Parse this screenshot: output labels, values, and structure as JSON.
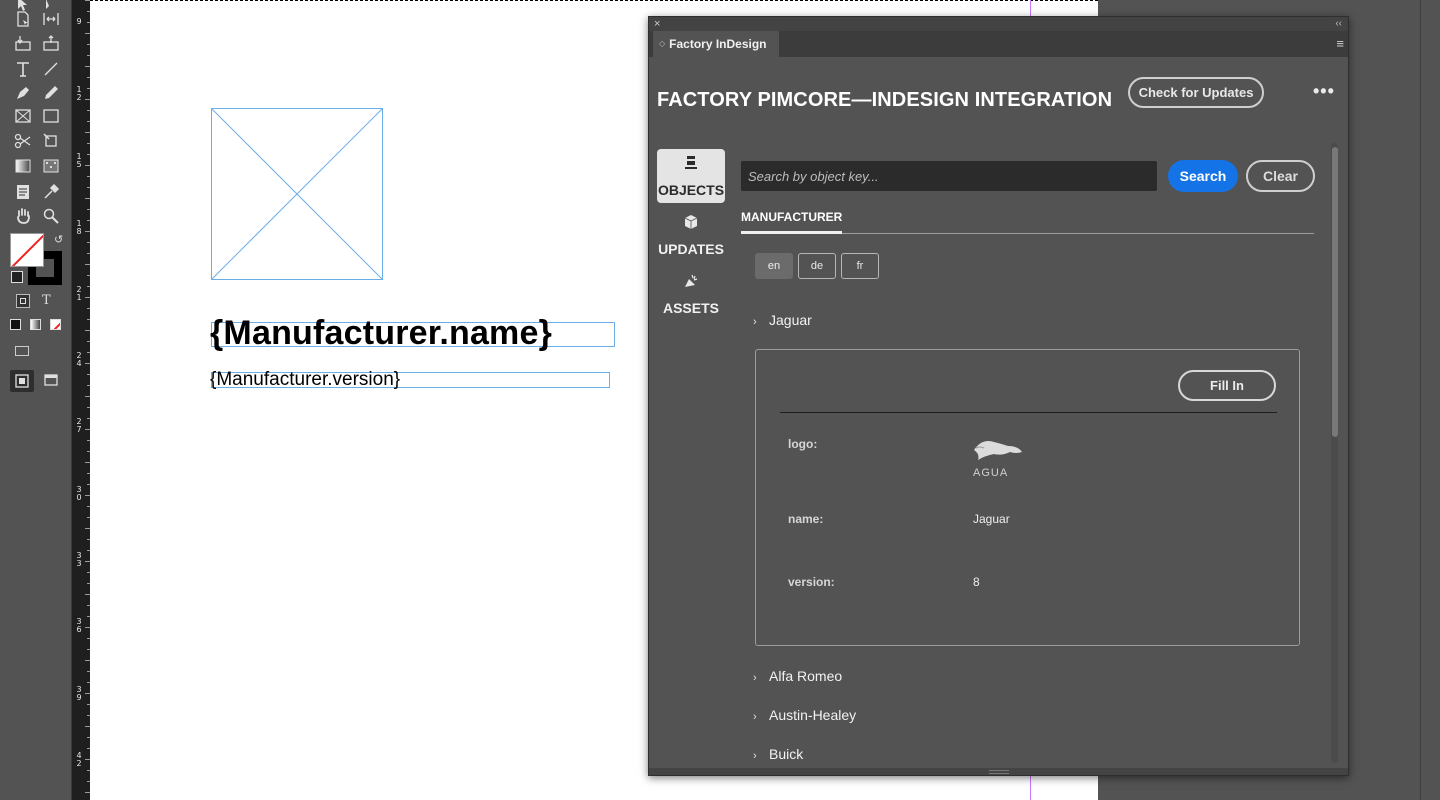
{
  "document": {
    "name_field": "{Manufacturer.name}",
    "version_field": "{Manufacturer.version}"
  },
  "ruler": {
    "labels": [
      "9",
      "1\n2",
      "1\n5",
      "1\n8",
      "2\n1",
      "2\n4",
      "2\n7",
      "3\n0",
      "3\n3",
      "3\n6",
      "3\n9",
      "4\n2"
    ]
  },
  "tools": [
    "direct-selection-tool-icon",
    "gap-tool-icon",
    "page-tool-icon",
    "content-collector-icon",
    "type-tool-icon",
    "line-tool-icon",
    "pen-tool-icon",
    "pencil-tool-icon",
    "rectangle-frame-tool-icon",
    "rectangle-tool-icon",
    "scissors-tool-icon",
    "free-transform-tool-icon",
    "gradient-swatch-tool-icon",
    "gradient-feather-tool-icon",
    "note-tool-icon",
    "eyedropper-tool-icon",
    "hand-tool-icon",
    "zoom-tool-icon"
  ],
  "panel": {
    "tab_label": "Factory InDesign",
    "app_title": "FACTORY PIMCORE—INDESIGN INTEGRATION",
    "check_updates": "Check for Updates",
    "more": "•••",
    "nav": [
      {
        "label": "OBJECTS",
        "icon": "objects-icon",
        "active": true
      },
      {
        "label": "UPDATES",
        "icon": "updates-icon",
        "active": false
      },
      {
        "label": "ASSETS",
        "icon": "assets-icon",
        "active": false
      }
    ],
    "search": {
      "placeholder": "Search by object key...",
      "value": "",
      "search_label": "Search",
      "clear_label": "Clear"
    },
    "tab": "MANUFACTURER",
    "languages": [
      {
        "code": "en",
        "selected": true
      },
      {
        "code": "de",
        "selected": false
      },
      {
        "code": "fr",
        "selected": false
      }
    ],
    "expanded_item": {
      "title": "Jaguar",
      "fill_in": "Fill In",
      "fields": [
        {
          "label": "logo:",
          "value": "",
          "type": "image",
          "image_name": "jaguar-logo"
        },
        {
          "label": "name:",
          "value": "Jaguar",
          "type": "text"
        },
        {
          "label": "version:",
          "value": "8",
          "type": "text"
        }
      ]
    },
    "items": [
      "Alfa Romeo",
      "Austin-Healey",
      "Buick"
    ]
  },
  "colors": {
    "accent": "#1473e6",
    "panel_bg": "#535353",
    "frame_guide": "#6aaee8"
  }
}
